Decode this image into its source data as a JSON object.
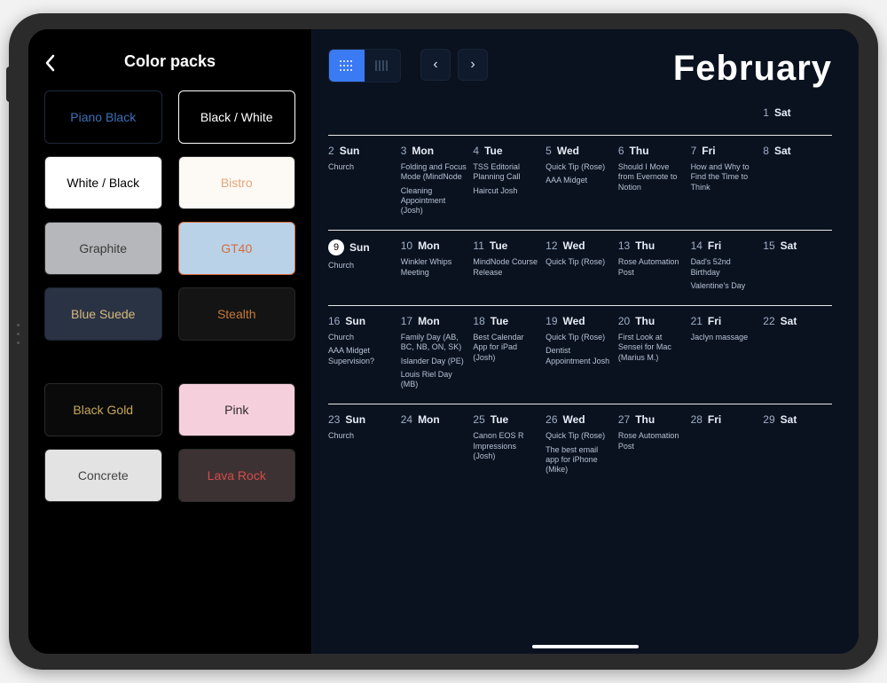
{
  "sidebar": {
    "title": "Color packs",
    "packs": [
      {
        "label": "Piano Black",
        "bg": "#000000",
        "fg": "#3e6fb8",
        "border": "#1c2a3b"
      },
      {
        "label": "Black / White",
        "bg": "#000000",
        "fg": "#ffffff",
        "border": "#ffffff",
        "selected": true
      },
      {
        "label": "White / Black",
        "bg": "#ffffff",
        "fg": "#000000",
        "border": "#333333"
      },
      {
        "label": "Bistro",
        "bg": "#fdf9f4",
        "fg": "#e2a77a",
        "border": "#2a2a2a"
      },
      {
        "label": "Graphite",
        "bg": "#b6b7ba",
        "fg": "#3b3b3b",
        "border": "#2a2a2a"
      },
      {
        "label": "GT40",
        "bg": "#b9d2e8",
        "fg": "#d86a3b",
        "border": "#d86a3b"
      },
      {
        "label": "Blue Suede",
        "bg": "#2a3344",
        "fg": "#d8b97a",
        "border": "#1b2230"
      },
      {
        "label": "Stealth",
        "bg": "#141414",
        "fg": "#c67a3b",
        "border": "#262626"
      }
    ],
    "group2": [
      {
        "label": "Black Gold",
        "bg": "#0a0a0a",
        "fg": "#c6a85a",
        "border": "#2a2a2a"
      },
      {
        "label": "Pink",
        "bg": "#f6cfdd",
        "fg": "#2d2d2d",
        "border": "#2a2a2a"
      },
      {
        "label": "Concrete",
        "bg": "#e3e3e3",
        "fg": "#444444",
        "border": "#2a2a2a"
      },
      {
        "label": "Lava Rock",
        "bg": "#3d3233",
        "fg": "#d44c4c",
        "border": "#2a2a2a"
      }
    ]
  },
  "calendar": {
    "month": "February",
    "nav": {
      "prev": "‹",
      "next": "›"
    },
    "view": {
      "dots_active": true
    },
    "weeks": [
      [
        {
          "blank": true
        },
        {
          "blank": true
        },
        {
          "blank": true
        },
        {
          "blank": true
        },
        {
          "blank": true
        },
        {
          "blank": true
        },
        {
          "d": 1,
          "dow": "Sat",
          "events": []
        }
      ],
      [
        {
          "d": 2,
          "dow": "Sun",
          "events": [
            "Church"
          ]
        },
        {
          "d": 3,
          "dow": "Mon",
          "events": [
            "Folding and Focus Mode (MindNode",
            "Cleaning Appointment (Josh)"
          ]
        },
        {
          "d": 4,
          "dow": "Tue",
          "events": [
            "TSS Editorial Planning Call",
            "Haircut Josh"
          ]
        },
        {
          "d": 5,
          "dow": "Wed",
          "events": [
            "Quick Tip (Rose)",
            "AAA Midget"
          ]
        },
        {
          "d": 6,
          "dow": "Thu",
          "events": [
            "Should I Move from Evernote to Notion"
          ]
        },
        {
          "d": 7,
          "dow": "Fri",
          "events": [
            "How and Why to Find the Time to Think"
          ]
        },
        {
          "d": 8,
          "dow": "Sat",
          "events": []
        }
      ],
      [
        {
          "d": 9,
          "dow": "Sun",
          "today": true,
          "events": [
            "Church"
          ]
        },
        {
          "d": 10,
          "dow": "Mon",
          "events": [
            "Winkler Whips Meeting"
          ]
        },
        {
          "d": 11,
          "dow": "Tue",
          "events": [
            "MindNode Course Release"
          ]
        },
        {
          "d": 12,
          "dow": "Wed",
          "events": [
            "Quick Tip (Rose)"
          ]
        },
        {
          "d": 13,
          "dow": "Thu",
          "events": [
            "Rose Automation Post"
          ]
        },
        {
          "d": 14,
          "dow": "Fri",
          "events": [
            "Dad's 52nd Birthday",
            "Valentine’s Day"
          ]
        },
        {
          "d": 15,
          "dow": "Sat",
          "events": []
        }
      ],
      [
        {
          "d": 16,
          "dow": "Sun",
          "events": [
            "Church",
            "AAA Midget Supervision?"
          ]
        },
        {
          "d": 17,
          "dow": "Mon",
          "events": [
            "Family Day (AB, BC, NB, ON, SK)",
            "Islander Day (PE)",
            "Louis Riel Day (MB)"
          ]
        },
        {
          "d": 18,
          "dow": "Tue",
          "events": [
            "Best Calendar App for iPad (Josh)"
          ]
        },
        {
          "d": 19,
          "dow": "Wed",
          "events": [
            "Quick Tip (Rose)",
            "Dentist Appointment Josh"
          ]
        },
        {
          "d": 20,
          "dow": "Thu",
          "events": [
            "First Look at Sensei for Mac (Marius M.)"
          ]
        },
        {
          "d": 21,
          "dow": "Fri",
          "events": [
            "Jaclyn massage"
          ]
        },
        {
          "d": 22,
          "dow": "Sat",
          "events": []
        }
      ],
      [
        {
          "d": 23,
          "dow": "Sun",
          "events": [
            "Church"
          ]
        },
        {
          "d": 24,
          "dow": "Mon",
          "events": []
        },
        {
          "d": 25,
          "dow": "Tue",
          "events": [
            "Canon EOS R Impressions (Josh)"
          ]
        },
        {
          "d": 26,
          "dow": "Wed",
          "events": [
            "Quick Tip (Rose)",
            "The best email app for iPhone (Mike)"
          ]
        },
        {
          "d": 27,
          "dow": "Thu",
          "events": [
            "Rose Automation Post"
          ]
        },
        {
          "d": 28,
          "dow": "Fri",
          "events": []
        },
        {
          "d": 29,
          "dow": "Sat",
          "events": []
        }
      ]
    ]
  }
}
